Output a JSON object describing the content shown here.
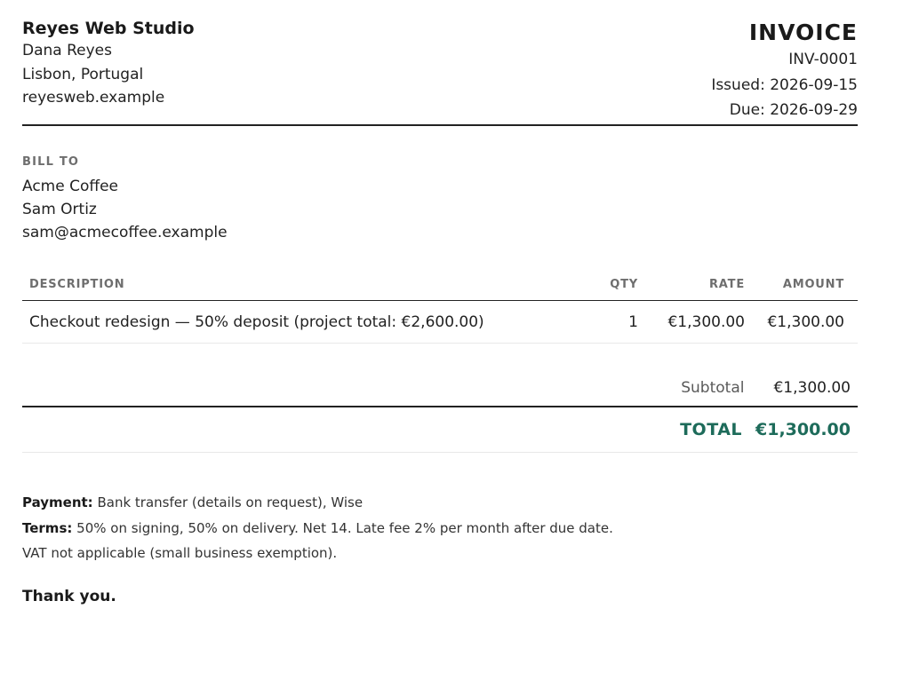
{
  "sender": {
    "studio": "Reyes Web Studio",
    "name": "Dana Reyes",
    "location": "Lisbon, Portugal",
    "website": "reyesweb.example"
  },
  "invoice": {
    "title": "INVOICE",
    "number": "INV-0001",
    "issued": "Issued: 2026-09-15",
    "due": "Due: 2026-09-29"
  },
  "bill_to": {
    "label": "BILL TO",
    "company": "Acme Coffee",
    "contact": "Sam Ortiz",
    "email": "sam@acmecoffee.example"
  },
  "items": {
    "headers": {
      "description": "DESCRIPTION",
      "qty": "QTY",
      "rate": "RATE",
      "amount": "AMOUNT"
    },
    "rows": [
      {
        "description": "Checkout redesign — 50% deposit (project total: €2,600.00)",
        "qty": "1",
        "rate": "€1,300.00",
        "amount": "€1,300.00"
      }
    ]
  },
  "totals": {
    "subtotal_label": "Subtotal",
    "subtotal_value": "€1,300.00",
    "total_label": "TOTAL",
    "total_value": "€1,300.00",
    "accent_color": "#1d6b5a"
  },
  "notes": {
    "payment_label": "Payment:",
    "payment_text": "Bank transfer (details on request), Wise",
    "terms_label": "Terms:",
    "terms_text": "50% on signing, 50% on delivery. Net 14. Late fee 2% per month after due date.",
    "vat": "VAT not applicable (small business exemption).",
    "thanks": "Thank you."
  }
}
